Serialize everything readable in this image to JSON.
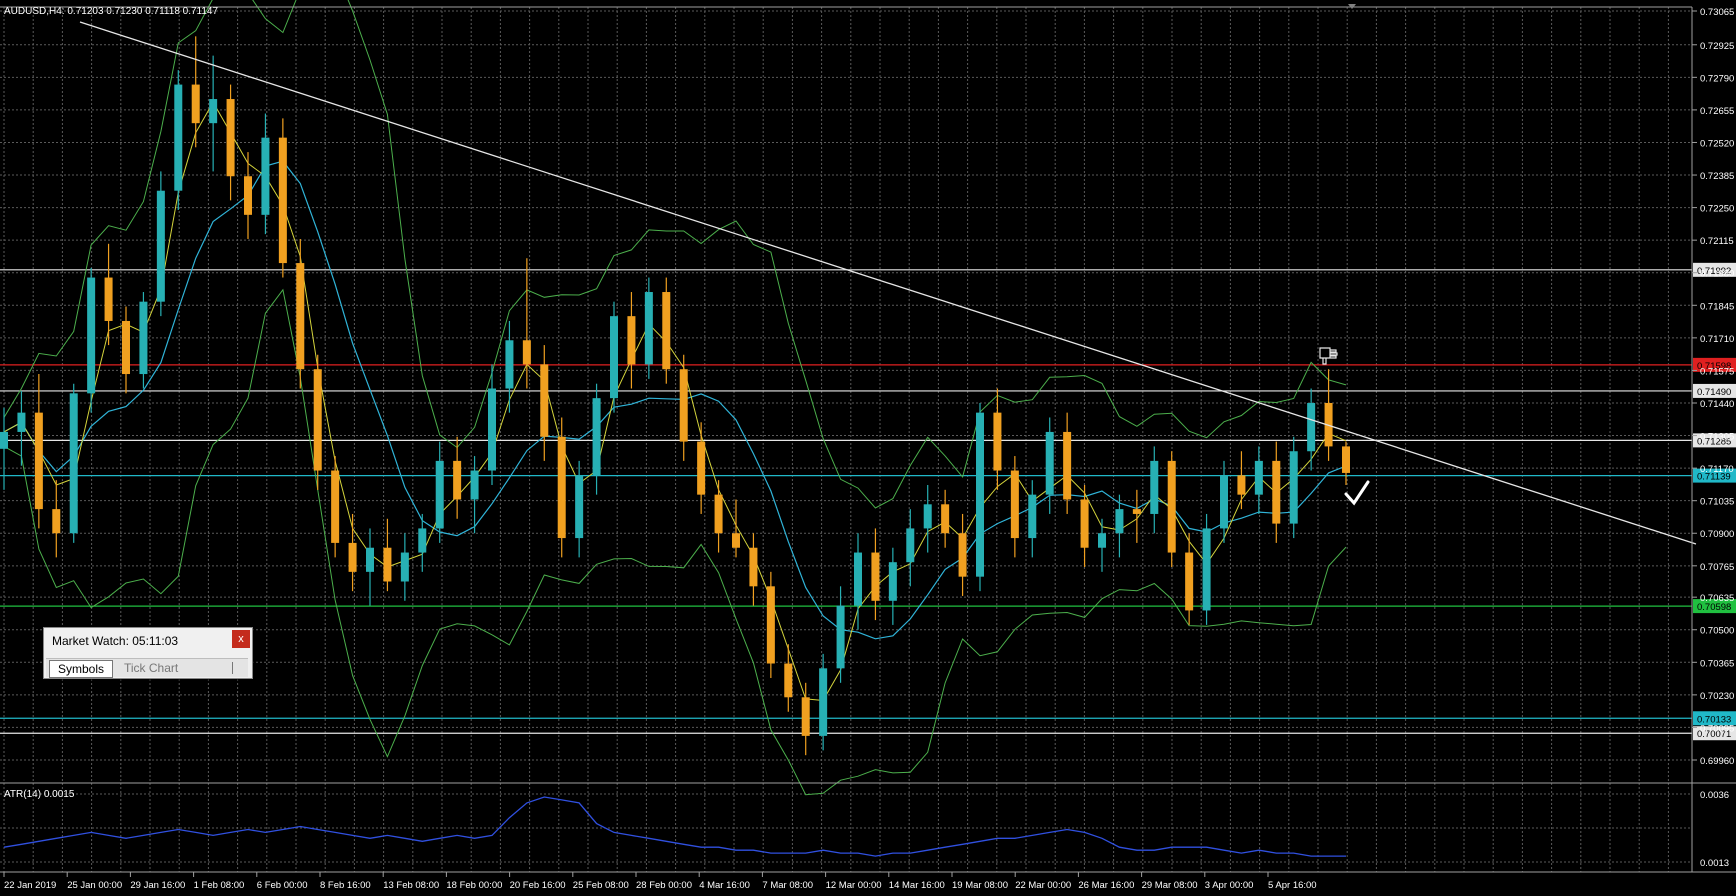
{
  "chart_info": {
    "symbol_label": "AUDUSD,H4:",
    "ohlc": "0.71203 0.71230 0.71118 0.71147",
    "indicator_label": "ATR(14) 0.0015"
  },
  "colors": {
    "background": "#000000",
    "grid": "#5a5a5a",
    "bull_candle": "#27b0b4",
    "bear_candle": "#f0a020",
    "bollinger": "#4caf4c",
    "ma_fast": "#d4d43c",
    "ma_slow": "#30b4d8",
    "trendline": "#e6e6e6",
    "atr": "#3050e0",
    "level_red": "#e02020",
    "level_white": "#e6e6e6",
    "level_cyan": "#20b8c8",
    "level_green": "#20c040"
  },
  "price_axis": {
    "ylim": [
      0.6996,
      0.73065
    ],
    "labels": [
      "0.73065",
      "0.72925",
      "0.72790",
      "0.72655",
      "0.72520",
      "0.72385",
      "0.72250",
      "0.72115",
      "0.71980",
      "0.71845",
      "0.71710",
      "0.71575",
      "0.71440",
      "0.71305",
      "0.71170",
      "0.71035",
      "0.70900",
      "0.70765",
      "0.70635",
      "0.70500",
      "0.70365",
      "0.70230",
      "0.70095",
      "0.69960"
    ]
  },
  "levels": [
    {
      "price": 0.71598,
      "label": "0.71598",
      "color": "#e02020"
    },
    {
      "price": 0.71992,
      "label": "0.71992",
      "color": "#e6e6e6"
    },
    {
      "price": 0.7149,
      "label": "0.71490",
      "color": "#e6e6e6"
    },
    {
      "price": 0.71285,
      "label": "0.71285",
      "color": "#e6e6e6"
    },
    {
      "price": 0.71139,
      "label": "0.71139",
      "color": "#20b8c8"
    },
    {
      "price": 0.70598,
      "label": "0.70598",
      "color": "#20c040"
    },
    {
      "price": 0.70133,
      "label": "0.70133",
      "color": "#20b8c8"
    },
    {
      "price": 0.70071,
      "label": "0.70071",
      "color": "#e6e6e6"
    }
  ],
  "atr_axis": {
    "ylim": [
      0.0013,
      0.0036
    ],
    "labels": [
      "0.0036",
      "0.0013"
    ]
  },
  "time_axis": {
    "labels": [
      "22 Jan 2019",
      "25 Jan 00:00",
      "29 Jan 16:00",
      "1 Feb 08:00",
      "6 Feb 00:00",
      "8 Feb 16:00",
      "13 Feb 08:00",
      "18 Feb 00:00",
      "20 Feb 16:00",
      "25 Feb 08:00",
      "28 Feb 00:00",
      "4 Mar 16:00",
      "7 Mar 08:00",
      "12 Mar 00:00",
      "14 Mar 16:00",
      "19 Mar 08:00",
      "22 Mar 00:00",
      "26 Mar 16:00",
      "29 Mar 08:00",
      "3 Apr 00:00",
      "5 Apr 16:00"
    ]
  },
  "market_watch": {
    "title": "Market Watch: 05:11:03",
    "close_label": "x",
    "tabs": [
      "Symbols",
      "Tick Chart"
    ]
  },
  "chart_data": {
    "type": "candlestick",
    "series": [
      {
        "name": "AUDUSD,H4",
        "type": "candlestick",
        "points": [
          {
            "o": 0.7125,
            "h": 0.7142,
            "l": 0.7108,
            "c": 0.7132
          },
          {
            "o": 0.7132,
            "h": 0.7149,
            "l": 0.7118,
            "c": 0.714
          },
          {
            "o": 0.714,
            "h": 0.7156,
            "l": 0.7092,
            "c": 0.71
          },
          {
            "o": 0.71,
            "h": 0.7112,
            "l": 0.708,
            "c": 0.709
          },
          {
            "o": 0.709,
            "h": 0.7152,
            "l": 0.7086,
            "c": 0.7148
          },
          {
            "o": 0.7148,
            "h": 0.72,
            "l": 0.714,
            "c": 0.7196
          },
          {
            "o": 0.7196,
            "h": 0.721,
            "l": 0.7168,
            "c": 0.7178
          },
          {
            "o": 0.7178,
            "h": 0.7184,
            "l": 0.7148,
            "c": 0.7156
          },
          {
            "o": 0.7156,
            "h": 0.719,
            "l": 0.715,
            "c": 0.7186
          },
          {
            "o": 0.7186,
            "h": 0.724,
            "l": 0.718,
            "c": 0.7232
          },
          {
            "o": 0.7232,
            "h": 0.7282,
            "l": 0.7224,
            "c": 0.7276
          },
          {
            "o": 0.7276,
            "h": 0.7296,
            "l": 0.725,
            "c": 0.726
          },
          {
            "o": 0.726,
            "h": 0.7288,
            "l": 0.724,
            "c": 0.727
          },
          {
            "o": 0.727,
            "h": 0.7276,
            "l": 0.7228,
            "c": 0.7238
          },
          {
            "o": 0.7238,
            "h": 0.7248,
            "l": 0.7212,
            "c": 0.7222
          },
          {
            "o": 0.7222,
            "h": 0.7264,
            "l": 0.7214,
            "c": 0.7254
          },
          {
            "o": 0.7254,
            "h": 0.7262,
            "l": 0.7196,
            "c": 0.7202
          },
          {
            "o": 0.7202,
            "h": 0.7212,
            "l": 0.715,
            "c": 0.7158
          },
          {
            "o": 0.7158,
            "h": 0.7164,
            "l": 0.7108,
            "c": 0.7116
          },
          {
            "o": 0.7116,
            "h": 0.7122,
            "l": 0.708,
            "c": 0.7086
          },
          {
            "o": 0.7086,
            "h": 0.7098,
            "l": 0.7066,
            "c": 0.7074
          },
          {
            "o": 0.7074,
            "h": 0.7092,
            "l": 0.706,
            "c": 0.7084
          },
          {
            "o": 0.7084,
            "h": 0.7096,
            "l": 0.7066,
            "c": 0.707
          },
          {
            "o": 0.707,
            "h": 0.709,
            "l": 0.7062,
            "c": 0.7082
          },
          {
            "o": 0.7082,
            "h": 0.7098,
            "l": 0.7074,
            "c": 0.7092
          },
          {
            "o": 0.7092,
            "h": 0.7128,
            "l": 0.7086,
            "c": 0.712
          },
          {
            "o": 0.712,
            "h": 0.713,
            "l": 0.7096,
            "c": 0.7104
          },
          {
            "o": 0.7104,
            "h": 0.7122,
            "l": 0.709,
            "c": 0.7116
          },
          {
            "o": 0.7116,
            "h": 0.716,
            "l": 0.711,
            "c": 0.715
          },
          {
            "o": 0.715,
            "h": 0.7178,
            "l": 0.714,
            "c": 0.717
          },
          {
            "o": 0.717,
            "h": 0.7204,
            "l": 0.715,
            "c": 0.716
          },
          {
            "o": 0.716,
            "h": 0.7168,
            "l": 0.712,
            "c": 0.713
          },
          {
            "o": 0.713,
            "h": 0.7138,
            "l": 0.708,
            "c": 0.7088
          },
          {
            "o": 0.7088,
            "h": 0.712,
            "l": 0.708,
            "c": 0.7114
          },
          {
            "o": 0.7114,
            "h": 0.7152,
            "l": 0.7106,
            "c": 0.7146
          },
          {
            "o": 0.7146,
            "h": 0.7186,
            "l": 0.714,
            "c": 0.718
          },
          {
            "o": 0.718,
            "h": 0.719,
            "l": 0.715,
            "c": 0.716
          },
          {
            "o": 0.716,
            "h": 0.7196,
            "l": 0.7154,
            "c": 0.719
          },
          {
            "o": 0.719,
            "h": 0.7196,
            "l": 0.7152,
            "c": 0.7158
          },
          {
            "o": 0.7158,
            "h": 0.7164,
            "l": 0.712,
            "c": 0.7128
          },
          {
            "o": 0.7128,
            "h": 0.7136,
            "l": 0.7098,
            "c": 0.7106
          },
          {
            "o": 0.7106,
            "h": 0.7112,
            "l": 0.7082,
            "c": 0.709
          },
          {
            "o": 0.709,
            "h": 0.7104,
            "l": 0.708,
            "c": 0.7084
          },
          {
            "o": 0.7084,
            "h": 0.709,
            "l": 0.706,
            "c": 0.7068
          },
          {
            "o": 0.7068,
            "h": 0.7074,
            "l": 0.703,
            "c": 0.7036
          },
          {
            "o": 0.7036,
            "h": 0.7044,
            "l": 0.7016,
            "c": 0.7022
          },
          {
            "o": 0.7022,
            "h": 0.7028,
            "l": 0.6998,
            "c": 0.7006
          },
          {
            "o": 0.7006,
            "h": 0.704,
            "l": 0.7,
            "c": 0.7034
          },
          {
            "o": 0.7034,
            "h": 0.7068,
            "l": 0.7028,
            "c": 0.706
          },
          {
            "o": 0.706,
            "h": 0.709,
            "l": 0.705,
            "c": 0.7082
          },
          {
            "o": 0.7082,
            "h": 0.7092,
            "l": 0.7054,
            "c": 0.7062
          },
          {
            "o": 0.7062,
            "h": 0.7084,
            "l": 0.7052,
            "c": 0.7078
          },
          {
            "o": 0.7078,
            "h": 0.71,
            "l": 0.7068,
            "c": 0.7092
          },
          {
            "o": 0.7092,
            "h": 0.711,
            "l": 0.7082,
            "c": 0.7102
          },
          {
            "o": 0.7102,
            "h": 0.7108,
            "l": 0.7084,
            "c": 0.709
          },
          {
            "o": 0.709,
            "h": 0.7098,
            "l": 0.7064,
            "c": 0.7072
          },
          {
            "o": 0.7072,
            "h": 0.7144,
            "l": 0.7066,
            "c": 0.714
          },
          {
            "o": 0.714,
            "h": 0.715,
            "l": 0.7108,
            "c": 0.7116
          },
          {
            "o": 0.7116,
            "h": 0.7122,
            "l": 0.708,
            "c": 0.7088
          },
          {
            "o": 0.7088,
            "h": 0.7112,
            "l": 0.708,
            "c": 0.7106
          },
          {
            "o": 0.7106,
            "h": 0.7138,
            "l": 0.7098,
            "c": 0.7132
          },
          {
            "o": 0.7132,
            "h": 0.714,
            "l": 0.7098,
            "c": 0.7104
          },
          {
            "o": 0.7104,
            "h": 0.711,
            "l": 0.7076,
            "c": 0.7084
          },
          {
            "o": 0.7084,
            "h": 0.7096,
            "l": 0.7074,
            "c": 0.709
          },
          {
            "o": 0.709,
            "h": 0.7106,
            "l": 0.708,
            "c": 0.71
          },
          {
            "o": 0.71,
            "h": 0.7108,
            "l": 0.7086,
            "c": 0.7098
          },
          {
            "o": 0.7098,
            "h": 0.7126,
            "l": 0.709,
            "c": 0.712
          },
          {
            "o": 0.712,
            "h": 0.7124,
            "l": 0.7076,
            "c": 0.7082
          },
          {
            "o": 0.7082,
            "h": 0.709,
            "l": 0.7052,
            "c": 0.7058
          },
          {
            "o": 0.7058,
            "h": 0.7098,
            "l": 0.7052,
            "c": 0.7092
          },
          {
            "o": 0.7092,
            "h": 0.712,
            "l": 0.7086,
            "c": 0.7114
          },
          {
            "o": 0.7114,
            "h": 0.7124,
            "l": 0.71,
            "c": 0.7106
          },
          {
            "o": 0.7106,
            "h": 0.7126,
            "l": 0.7098,
            "c": 0.712
          },
          {
            "o": 0.712,
            "h": 0.7128,
            "l": 0.7086,
            "c": 0.7094
          },
          {
            "o": 0.7094,
            "h": 0.713,
            "l": 0.7088,
            "c": 0.7124
          },
          {
            "o": 0.7124,
            "h": 0.715,
            "l": 0.7116,
            "c": 0.7144
          },
          {
            "o": 0.7144,
            "h": 0.7158,
            "l": 0.712,
            "c": 0.7126
          },
          {
            "o": 0.7126,
            "h": 0.7128,
            "l": 0.711,
            "c": 0.7115
          }
        ]
      },
      {
        "name": "ATR(14)",
        "type": "line",
        "values": [
          0.0018,
          0.0019,
          0.002,
          0.0021,
          0.0022,
          0.0023,
          0.0022,
          0.0021,
          0.0022,
          0.0023,
          0.0024,
          0.0023,
          0.0022,
          0.0023,
          0.0024,
          0.0023,
          0.0024,
          0.0025,
          0.0024,
          0.0023,
          0.0022,
          0.0021,
          0.0022,
          0.0021,
          0.002,
          0.0021,
          0.0022,
          0.0021,
          0.0022,
          0.0028,
          0.0033,
          0.0035,
          0.0034,
          0.0033,
          0.0026,
          0.0023,
          0.0022,
          0.0021,
          0.002,
          0.0019,
          0.0018,
          0.0018,
          0.0017,
          0.0017,
          0.0016,
          0.0016,
          0.0016,
          0.0017,
          0.0016,
          0.0016,
          0.0015,
          0.0016,
          0.0016,
          0.0017,
          0.0018,
          0.0019,
          0.002,
          0.0021,
          0.0021,
          0.0022,
          0.0023,
          0.0024,
          0.0023,
          0.0021,
          0.0018,
          0.0017,
          0.0017,
          0.0018,
          0.0018,
          0.0018,
          0.0017,
          0.0016,
          0.0017,
          0.0016,
          0.0016,
          0.0015,
          0.0015,
          0.0015
        ]
      }
    ],
    "xlabel": "",
    "ylabel": "",
    "grid": true
  }
}
